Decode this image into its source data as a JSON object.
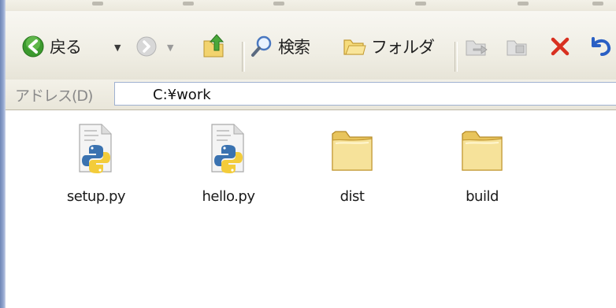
{
  "toolbar": {
    "back_label": "戻る",
    "search_label": "検索",
    "folders_label": "フォルダ"
  },
  "address": {
    "label": "アドレス(D)",
    "value": "C:¥work"
  },
  "files": [
    {
      "name": "setup.py",
      "icon": "python-file-icon"
    },
    {
      "name": "hello.py",
      "icon": "python-file-icon"
    },
    {
      "name": "dist",
      "icon": "folder-icon"
    },
    {
      "name": "build",
      "icon": "folder-icon"
    }
  ],
  "colors": {
    "back_green": "#3c9a2e",
    "delete_red": "#d83020",
    "undo_blue": "#2a5fc4",
    "folder_yellow": "#f4de8a",
    "python_blue": "#3a72b0",
    "python_yellow": "#f3cc3a"
  }
}
